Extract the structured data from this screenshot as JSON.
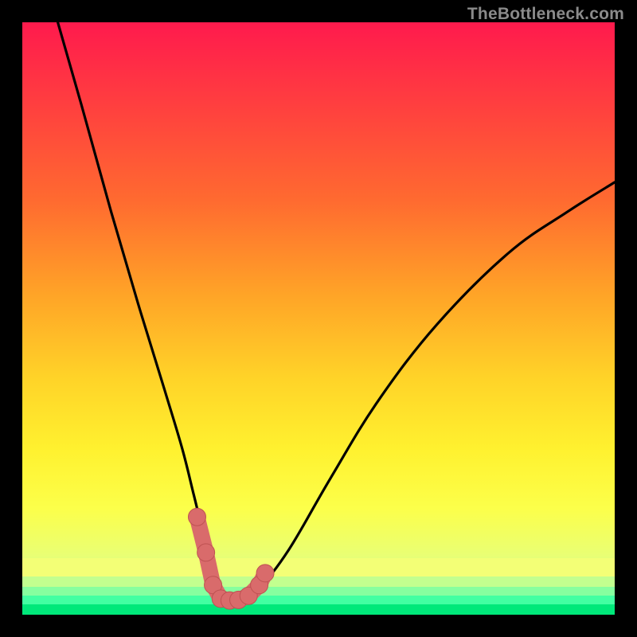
{
  "watermark": "TheBottleneck.com",
  "colors": {
    "frame": "#000000",
    "curve_stroke": "#000000",
    "marker_fill": "#d96b6b",
    "marker_stroke": "#be5252",
    "gradient_stops": [
      {
        "pct": 0.0,
        "color": "#ff1a4d"
      },
      {
        "pct": 0.14,
        "color": "#ff3f3f"
      },
      {
        "pct": 0.3,
        "color": "#ff6a30"
      },
      {
        "pct": 0.46,
        "color": "#ffa427"
      },
      {
        "pct": 0.6,
        "color": "#ffd328"
      },
      {
        "pct": 0.72,
        "color": "#fff12f"
      },
      {
        "pct": 0.82,
        "color": "#fcff4a"
      },
      {
        "pct": 0.9,
        "color": "#e9ff74"
      },
      {
        "pct": 0.935,
        "color": "#c8ff8e"
      },
      {
        "pct": 0.955,
        "color": "#9cffa0"
      },
      {
        "pct": 0.972,
        "color": "#5fffa5"
      },
      {
        "pct": 0.985,
        "color": "#2affa0"
      },
      {
        "pct": 1.0,
        "color": "#00ef7e"
      }
    ]
  },
  "chart_data": {
    "type": "line",
    "title": "",
    "xlabel": "",
    "ylabel": "",
    "xlim": [
      0,
      100
    ],
    "ylim": [
      0,
      100
    ],
    "series": [
      {
        "name": "bottleneck-curve",
        "x": [
          6,
          10,
          15,
          20,
          24,
          27,
          29,
          31,
          33,
          35,
          37,
          40,
          45,
          52,
          60,
          70,
          82,
          92,
          100
        ],
        "y": [
          100,
          86,
          68,
          51,
          38,
          28,
          20,
          12,
          5,
          2.5,
          2.5,
          4.5,
          11,
          23,
          36,
          49,
          61,
          68,
          73
        ]
      }
    ],
    "markers": {
      "name": "highlight-band",
      "x": [
        29.5,
        31.0,
        32.2,
        33.5,
        35.0,
        36.5,
        38.2,
        40.0,
        41.0
      ],
      "y": [
        16.5,
        10.5,
        5.0,
        2.7,
        2.4,
        2.5,
        3.2,
        5.0,
        7.0
      ]
    },
    "annotations": []
  }
}
